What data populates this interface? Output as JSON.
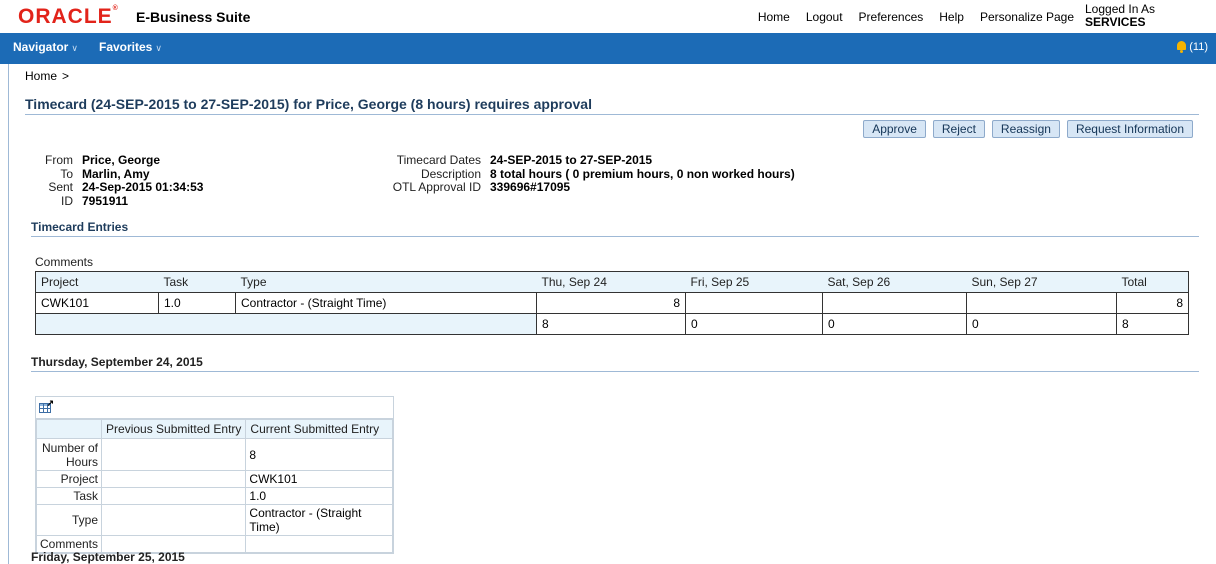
{
  "header": {
    "logo": "ORACLE",
    "suite": "E-Business Suite",
    "links": [
      "Home",
      "Logout",
      "Preferences",
      "Help",
      "Personalize Page"
    ],
    "logged_in_label": "Logged In As",
    "logged_in_user": "SERVICES"
  },
  "nav": {
    "navigator": "Navigator",
    "favorites": "Favorites",
    "notifications": "(11)"
  },
  "breadcrumb": {
    "home": "Home",
    "separator": ">"
  },
  "page_title": "Timecard (24-SEP-2015 to 27-SEP-2015) for Price, George (8 hours) requires approval",
  "actions": {
    "approve": "Approve",
    "reject": "Reject",
    "reassign": "Reassign",
    "request_info": "Request Information"
  },
  "notification": {
    "from_label": "From",
    "from": "Price, George",
    "to_label": "To",
    "to": "Marlin, Amy",
    "sent_label": "Sent",
    "sent": "24-Sep-2015 01:34:53",
    "id_label": "ID",
    "id": "7951911",
    "dates_label": "Timecard Dates",
    "dates": "24-SEP-2015 to 27-SEP-2015",
    "desc_label": "Description",
    "desc": "8 total hours ( 0 premium hours, 0 non worked hours)",
    "otl_label": "OTL Approval ID",
    "otl": "339696#17095"
  },
  "entries": {
    "section_title": "Timecard Entries",
    "comments_label": "Comments",
    "columns": [
      "Project",
      "Task",
      "Type",
      "Thu, Sep 24",
      "Fri, Sep 25",
      "Sat, Sep 26",
      "Sun, Sep 27",
      "Total"
    ],
    "row": {
      "project": "CWK101",
      "task": "1.0",
      "type": "Contractor - (Straight Time)",
      "thu": "8",
      "fri": "",
      "sat": "",
      "sun": "",
      "total": "8"
    },
    "totals": {
      "thu": "8",
      "fri": "0",
      "sat": "0",
      "sun": "0",
      "total": "8"
    }
  },
  "day1": {
    "title": "Thursday, September 24, 2015",
    "col_prev": "Previous Submitted Entry",
    "col_curr": "Current Submitted Entry",
    "rows": [
      {
        "label": "Number of Hours",
        "prev": "",
        "curr": "8"
      },
      {
        "label": "Project",
        "prev": "",
        "curr": "CWK101"
      },
      {
        "label": "Task",
        "prev": "",
        "curr": "1.0"
      },
      {
        "label": "Type",
        "prev": "",
        "curr": "Contractor - (Straight Time)"
      },
      {
        "label": "Comments",
        "prev": "",
        "curr": ""
      }
    ]
  },
  "day2": {
    "title": "Friday, September 25, 2015"
  }
}
